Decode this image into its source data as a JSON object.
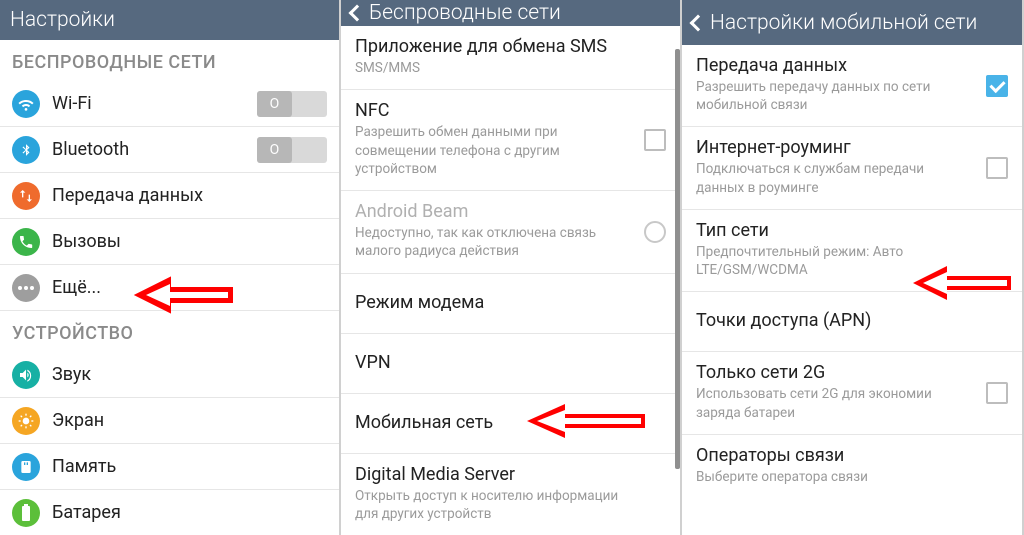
{
  "panel1": {
    "title": "Настройки",
    "section_wireless": "БЕСПРОВОДНЫЕ СЕТИ",
    "wifi": "Wi-Fi",
    "wifi_toggle": "O",
    "bluetooth": "Bluetooth",
    "bt_toggle": "O",
    "data": "Передача данных",
    "calls": "Вызовы",
    "more": "Ещё...",
    "section_device": "УСТРОЙСТВО",
    "sound": "Звук",
    "screen": "Экран",
    "memory": "Память",
    "battery": "Батарея"
  },
  "panel2": {
    "title": "Беспроводные сети",
    "sms_title": "Приложение для обмена SMS",
    "sms_sub": "SMS/MMS",
    "nfc_title": "NFC",
    "nfc_sub": "Разрешить обмен данными при совмещении телефона с другим устройством",
    "beam_title": "Android Beam",
    "beam_sub": "Недоступно, так как отключена связь малого радиуса действия",
    "tether": "Режим модема",
    "vpn": "VPN",
    "mobile": "Мобильная сеть",
    "dms_title": "Digital Media Server",
    "dms_sub": "Открыть доступ к носителю информации для других устройств"
  },
  "panel3": {
    "title": "Настройки мобильной сети",
    "data_title": "Передача данных",
    "data_sub": "Разрешить передачу данных по сети мобильной связи",
    "roam_title": "Интернет-роуминг",
    "roam_sub": "Подключаться к службам передачи данных в роуминге",
    "nettype_title": "Тип сети",
    "nettype_sub": "Предпочтительный режим: Авто LTE/GSM/WCDMA",
    "apn_title": "Точки доступа (APN)",
    "only2g_title": "Только сети 2G",
    "only2g_sub": "Использовать сети 2G для экономии заряда батареи",
    "ops_title": "Операторы связи",
    "ops_sub": "Выберите оператора связи"
  }
}
